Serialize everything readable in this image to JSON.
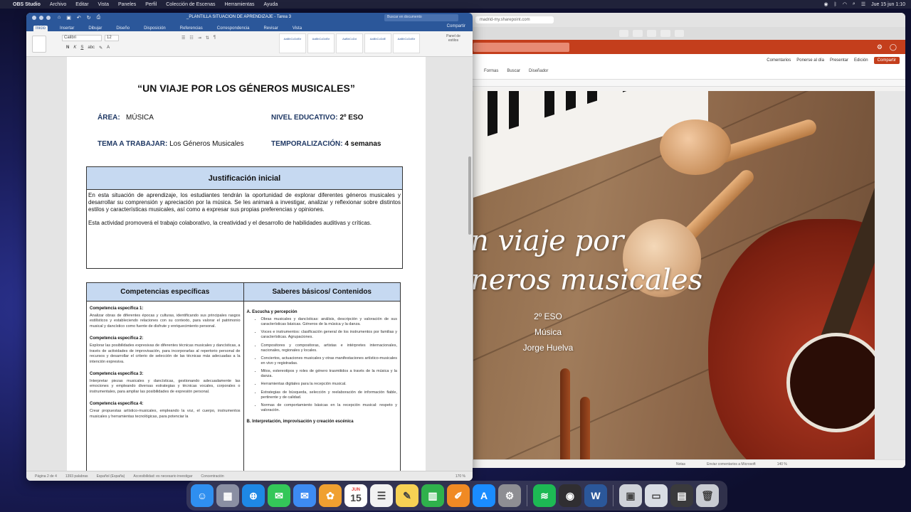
{
  "menubar": {
    "app": "OBS Studio",
    "menus": [
      "Archivo",
      "Editar",
      "Vista",
      "Paneles",
      "Perfil",
      "Colección de Escenas",
      "Herramientas",
      "Ayuda"
    ],
    "clock": "Jue 15 jun 1:10"
  },
  "word": {
    "title": "_PLANTILLA SITUACION DE APRENDIZAJE - Tarea 3",
    "search_placeholder": "Buscar en documento",
    "tabs": [
      "Inicio",
      "Insertar",
      "Dibujar",
      "Diseño",
      "Disposición",
      "Referencias",
      "Correspondencia",
      "Revisar",
      "Vista"
    ],
    "share": "Compartir",
    "font": "Calibri",
    "font_size": "12",
    "styles": [
      "AaBbCcDdEe",
      "AaBbCcDdEe",
      "AaBbCcDd",
      "AaBbCcDdE",
      "AaBbCcDdEe"
    ],
    "styles_pane": "Panel de estilos",
    "status": {
      "page": "Página 2 de 4",
      "words": "1393 palabras",
      "language": "Español (España)",
      "accessibility": "Accesibilidad: es necesario investigar",
      "focus": "Concentración",
      "zoom": "170 %"
    },
    "doc": {
      "title": "“UN VIAJE POR LOS GÉNEROS MUSICALES”",
      "area_label": "ÁREA:",
      "area_value": "MÚSICA",
      "nivel_label": "NIVEL EDUCATIVO:",
      "nivel_value": "2º ESO",
      "tema_label": "TEMA A TRABAJAR:",
      "tema_value": "Los Géneros Musicales",
      "temp_label": "TEMPORALIZACIÓN:",
      "temp_value": "4 semanas",
      "justificacion_title": "Justificación inicial",
      "justificacion_p1": "En esta situación de aprendizaje, los estudiantes tendrán la oportunidad de explorar diferentes géneros musicales y desarrollar su comprensión y apreciación por la música. Se les animará a investigar, analizar y reflexionar sobre distintos estilos y características musicales, así como a expresar sus propias preferencias y opiniones.",
      "justificacion_p2": "Esta actividad promoverá el trabajo colaborativo, la creatividad y el desarrollo de habilidades auditivas y críticas.",
      "table_h1": "Competencias específicas",
      "table_h2": "Saberes básicos/ Contenidos",
      "competencias": [
        {
          "h": "Competencia específica 1:",
          "t": "Analizar obras de diferentes épocas y culturas, identificando sus principales rasgos estilísticos y estableciendo relaciones con su contexto, para valorar el patrimonio musical y dancístico como fuente de disfrute y enriquecimiento personal."
        },
        {
          "h": "Competencia específica 2:",
          "t": "Explorar las posibilidades expresivas de diferentes técnicas musicales y dancísticas, a través de actividades de improvisación, para incorporarlas al repertorio personal de recursos y desarrollar el criterio de selección de las técnicas más adecuadas a la intención expresiva."
        },
        {
          "h": "Competencia específica 3:",
          "t": "Interpretar piezas musicales y dancísticas, gestionando adecuadamente las emociones y empleando diversas estrategias y técnicas vocales, corporales o instrumentales, para ampliar las posibilidades de expresión personal."
        },
        {
          "h": "Competencia específica 4:",
          "t": "Crear propuestas artístico-musicales, empleando la voz, el cuerpo, instrumentos musicales y herramientas tecnológicas, para potenciar la"
        }
      ],
      "saberes_section": "A. Escucha y percepción",
      "saberes": [
        "Obras musicales y dancísticas: análisis, descripción y valoración de sus características básicas. Géneros de la música y la danza.",
        "Voces e instrumentos: clasificación general de los instrumentos por familias y características. Agrupaciones.",
        "Compositores y compositoras, artistas e intérpretes internacionales, nacionales, regionales y locales.",
        "Conciertos, actuaciones musicales y otras manifestaciones artístico-musicales en vivo y registradas.",
        "Mitos, estereotipos y roles de género trasmitidos a través de la música y la danza.",
        "Herramientas digitales para la recepción musical.",
        "Estrategias de búsqueda, selección y reelaboración de información fiable, pertinente y de calidad.",
        "Normas de comportamiento básicas en la recepción musical: respeto y valoración."
      ],
      "saberes_next": "B. Interpretación, improvisación y creación escénica"
    }
  },
  "ppt": {
    "url": "madrid-my.sharepoint.com",
    "ribbon_actions": [
      "Comentarios",
      "Ponerse al día",
      "Presentar",
      "Edición",
      "Compartir"
    ],
    "ribbon_tools": [
      "Formas",
      "Buscar",
      "Diseñador"
    ],
    "slide": {
      "title_line1": "n viaje por",
      "title_line2": "neros musicales",
      "subtitle1": "2º ESO",
      "subtitle2": "Música",
      "subtitle3": "Jorge Huelva"
    },
    "status": [
      "Notas",
      "Enviar comentarios a Microsoft",
      "140 %"
    ]
  },
  "dock": {
    "apps": [
      {
        "name": "Finder",
        "color": "#2f8ff0",
        "glyph": "☺"
      },
      {
        "name": "Launchpad",
        "color": "#8a8fa3",
        "glyph": "▦"
      },
      {
        "name": "Safari",
        "color": "#1e88e5",
        "glyph": "⊕"
      },
      {
        "name": "Mensajes",
        "color": "#34c759",
        "glyph": "✉"
      },
      {
        "name": "Mail",
        "color": "#3d8bf2",
        "glyph": "✉"
      },
      {
        "name": "Fotos",
        "color": "#f0a030",
        "glyph": "✿"
      },
      {
        "name": "Calendario",
        "color": "#ffffff",
        "glyph": "15"
      },
      {
        "name": "Recordatorios",
        "color": "#f2f2f2",
        "glyph": "☰"
      },
      {
        "name": "Notas",
        "color": "#f7d154",
        "glyph": "✎"
      },
      {
        "name": "Numbers",
        "color": "#2fb14c",
        "glyph": "▥"
      },
      {
        "name": "Pages",
        "color": "#f08a24",
        "glyph": "✐"
      },
      {
        "name": "App Store",
        "color": "#1a8cff",
        "glyph": "A"
      },
      {
        "name": "Ajustes",
        "color": "#8e8e93",
        "glyph": "⚙"
      },
      {
        "name": "Spotify",
        "color": "#1db954",
        "glyph": "≋"
      },
      {
        "name": "OBS",
        "color": "#302e31",
        "glyph": "◉"
      },
      {
        "name": "Word",
        "color": "#2b579a",
        "glyph": "W"
      },
      {
        "name": "Vista previa",
        "color": "#cfd2d8",
        "glyph": "▣"
      },
      {
        "name": "Capturas",
        "color": "#d9dde4",
        "glyph": "▭"
      },
      {
        "name": "Monitor",
        "color": "#3a3a3c",
        "glyph": "▤"
      },
      {
        "name": "Papelera",
        "color": "#c9ccd2",
        "glyph": "🗑"
      }
    ],
    "calendar_month": "JUN"
  }
}
